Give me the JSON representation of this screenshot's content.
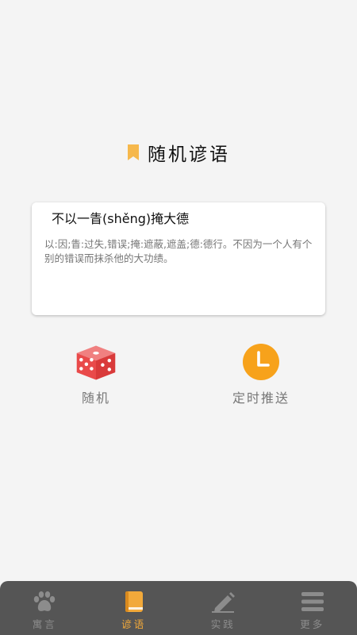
{
  "page": {
    "title": "随机谚语",
    "title_icon": "bookmark-icon"
  },
  "card": {
    "idiom": "不以一眚(shěng)掩大德",
    "explanation": "以:因;眚:过失,错误;掩:遮蔽,遮盖;德:德行。不因为一个人有个别的错误而抹杀他的大功绩。"
  },
  "actions": {
    "random": {
      "label": "随机",
      "icon": "dice-icon"
    },
    "push": {
      "label": "定时推送",
      "icon": "clock-icon"
    }
  },
  "tabs": [
    {
      "label": "寓言",
      "icon": "paw-icon",
      "active": false
    },
    {
      "label": "谚语",
      "icon": "book-icon",
      "active": true
    },
    {
      "label": "实践",
      "icon": "pencil-icon",
      "active": false
    },
    {
      "label": "更多",
      "icon": "menu-icon",
      "active": false
    }
  ],
  "colors": {
    "accent": "#f2a93a",
    "dice_red": "#e94a4a",
    "clock_orange": "#f7a21b",
    "tabbar_bg": "#555555",
    "tab_inactive": "#8c8c8c"
  }
}
